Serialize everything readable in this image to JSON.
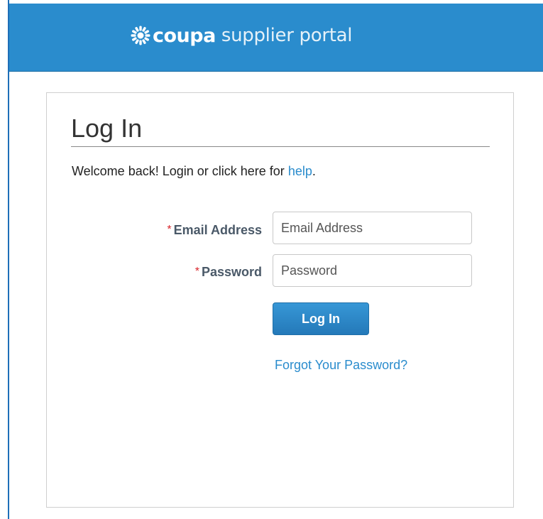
{
  "header": {
    "brand": "coupa",
    "product": "supplier portal",
    "colors": {
      "background": "#2a8ccd",
      "text": "#ffffff"
    }
  },
  "login": {
    "title": "Log In",
    "welcome_text": "Welcome back! Login or click here for",
    "help_link": "help",
    "welcome_suffix": ".",
    "email": {
      "required_marker": "*",
      "label": "Email Address",
      "placeholder": "Email Address",
      "value": ""
    },
    "password": {
      "required_marker": "*",
      "label": "Password",
      "placeholder": "Password",
      "value": ""
    },
    "submit_label": "Log In",
    "forgot_password": "Forgot Your Password?"
  },
  "colors": {
    "accent": "#2a8ccd",
    "required": "#d9262c",
    "label": "#4a5968"
  },
  "icons": {
    "logo": "coupa-sunburst-icon"
  }
}
